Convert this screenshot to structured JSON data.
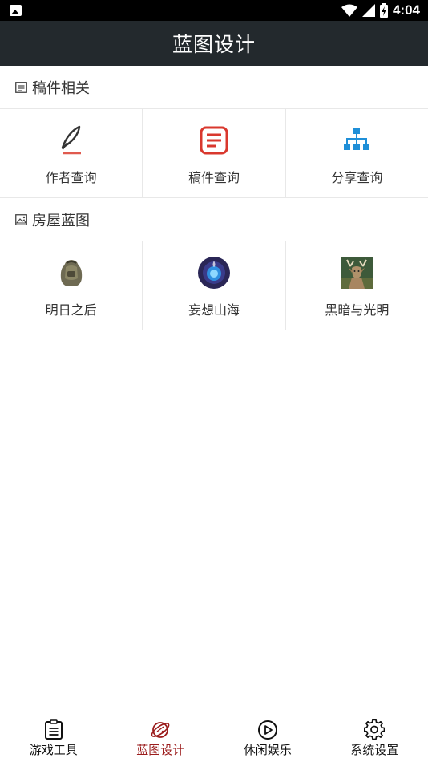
{
  "status_bar": {
    "time": "4:04"
  },
  "app_bar": {
    "title": "蓝图设计"
  },
  "sections": [
    {
      "title": "稿件相关",
      "icon": "document-icon",
      "items": [
        {
          "label": "作者查询",
          "icon": "quill-pen-icon"
        },
        {
          "label": "稿件查询",
          "icon": "document-list-icon"
        },
        {
          "label": "分享查询",
          "icon": "hierarchy-share-icon"
        }
      ]
    },
    {
      "title": "房屋蓝图",
      "icon": "image-icon",
      "items": [
        {
          "label": "明日之后",
          "icon": "backpack-game-icon"
        },
        {
          "label": "妄想山海",
          "icon": "blue-orb-game-icon"
        },
        {
          "label": "黑暗与光明",
          "icon": "deer-game-icon"
        }
      ]
    }
  ],
  "bottom_nav": {
    "active_index": 1,
    "active_color": "#9b1c1c",
    "items": [
      {
        "label": "游戏工具",
        "icon": "clipboard-list-icon"
      },
      {
        "label": "蓝图设计",
        "icon": "planet-icon"
      },
      {
        "label": "休闲娱乐",
        "icon": "play-circle-icon"
      },
      {
        "label": "系统设置",
        "icon": "gear-icon"
      }
    ]
  },
  "colors": {
    "app_bar": "#23292d",
    "accent_red": "#d9382e",
    "share_blue": "#1f8fd8"
  }
}
